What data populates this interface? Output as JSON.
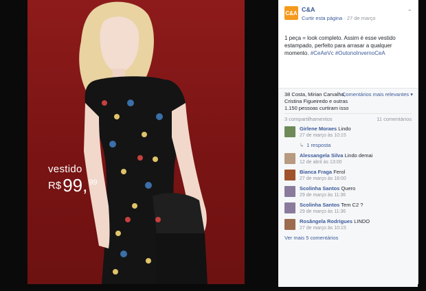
{
  "photo": {
    "price_label": "vestido",
    "price_currency": "R$",
    "price_integer": "99,",
    "price_cents": "99"
  },
  "page": {
    "logo_text": "C&A",
    "name": "C&A",
    "curtir": "Curtir esta página",
    "separator": "·",
    "date": "27 de março",
    "chevron": "⌄"
  },
  "post": {
    "text": "1 peça = look completo. Assim é esse vestido estampado, perfeito para arrasar a qualquer momento.",
    "tags": "#CeAeVc #OutonoInvernoCeA"
  },
  "reactions": {
    "likers": "38 Costa, Mirian Carvalho,",
    "likers2": "Cristina Figueiredo e outras",
    "count": "1.150 pessoas curtiram isso",
    "sort": "Comentários mais relevantes ▾",
    "shares": "3 compartilhamentos",
    "comments": "11 comentários"
  },
  "comments": [
    {
      "author": "Girlene Moraes",
      "text": " Lindo",
      "time": "27 de março às 10:15",
      "avatar": "#6d8a58"
    },
    {
      "author": "Alessangela Silva",
      "text": " Lindo demai",
      "time": "12 de abril às 13:00",
      "avatar": "#b89a80"
    },
    {
      "author": "Bianca Fraga",
      "text": " Ferol",
      "time": "27 de março às 18:00",
      "avatar": "#a0522d"
    },
    {
      "author": "Scolinha Santos",
      "text": " Quero",
      "time": "29 de março às 11:36",
      "avatar": "#8a7b9c"
    },
    {
      "author": "Scolinha Santos",
      "text": " Tem C2 ?",
      "time": "29 de março às 11:36",
      "avatar": "#8a7b9c"
    },
    {
      "author": "Rosângela Rodrigues",
      "text": " LINDO",
      "time": "27 de março às 10:15",
      "avatar": "#9c6b4f"
    }
  ],
  "reply": {
    "icon": "↳",
    "label": "1 resposta"
  },
  "more_comments": "Ver mais 5 comentários"
}
